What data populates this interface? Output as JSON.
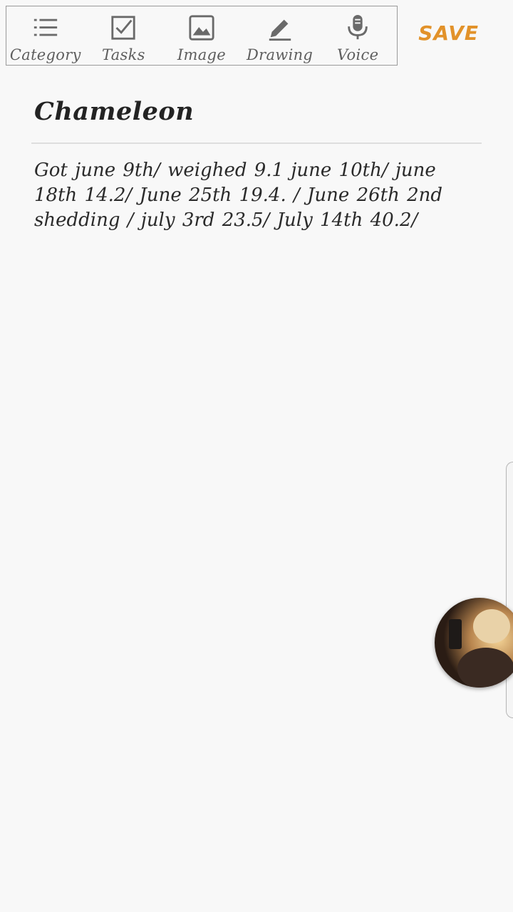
{
  "toolbar": {
    "items": [
      {
        "label": "Category",
        "icon": "list-icon"
      },
      {
        "label": "Tasks",
        "icon": "checkbox-icon"
      },
      {
        "label": "Image",
        "icon": "image-icon"
      },
      {
        "label": "Drawing",
        "icon": "pen-icon"
      },
      {
        "label": "Voice",
        "icon": "microphone-icon"
      }
    ],
    "save_label": "SAVE"
  },
  "note": {
    "title": "Chameleon",
    "body": "Got june 9th/ weighed 9.1 june 10th/ june 18th 14.2/ June 25th 19.4. / June 26th 2nd shedding / july 3rd 23.5/ July 14th 40.2/"
  },
  "floating": {
    "avatar_icon": "contact-avatar"
  },
  "colors": {
    "accent": "#e2922a",
    "background": "#f8f8f8",
    "icon": "#6a6a6a"
  }
}
